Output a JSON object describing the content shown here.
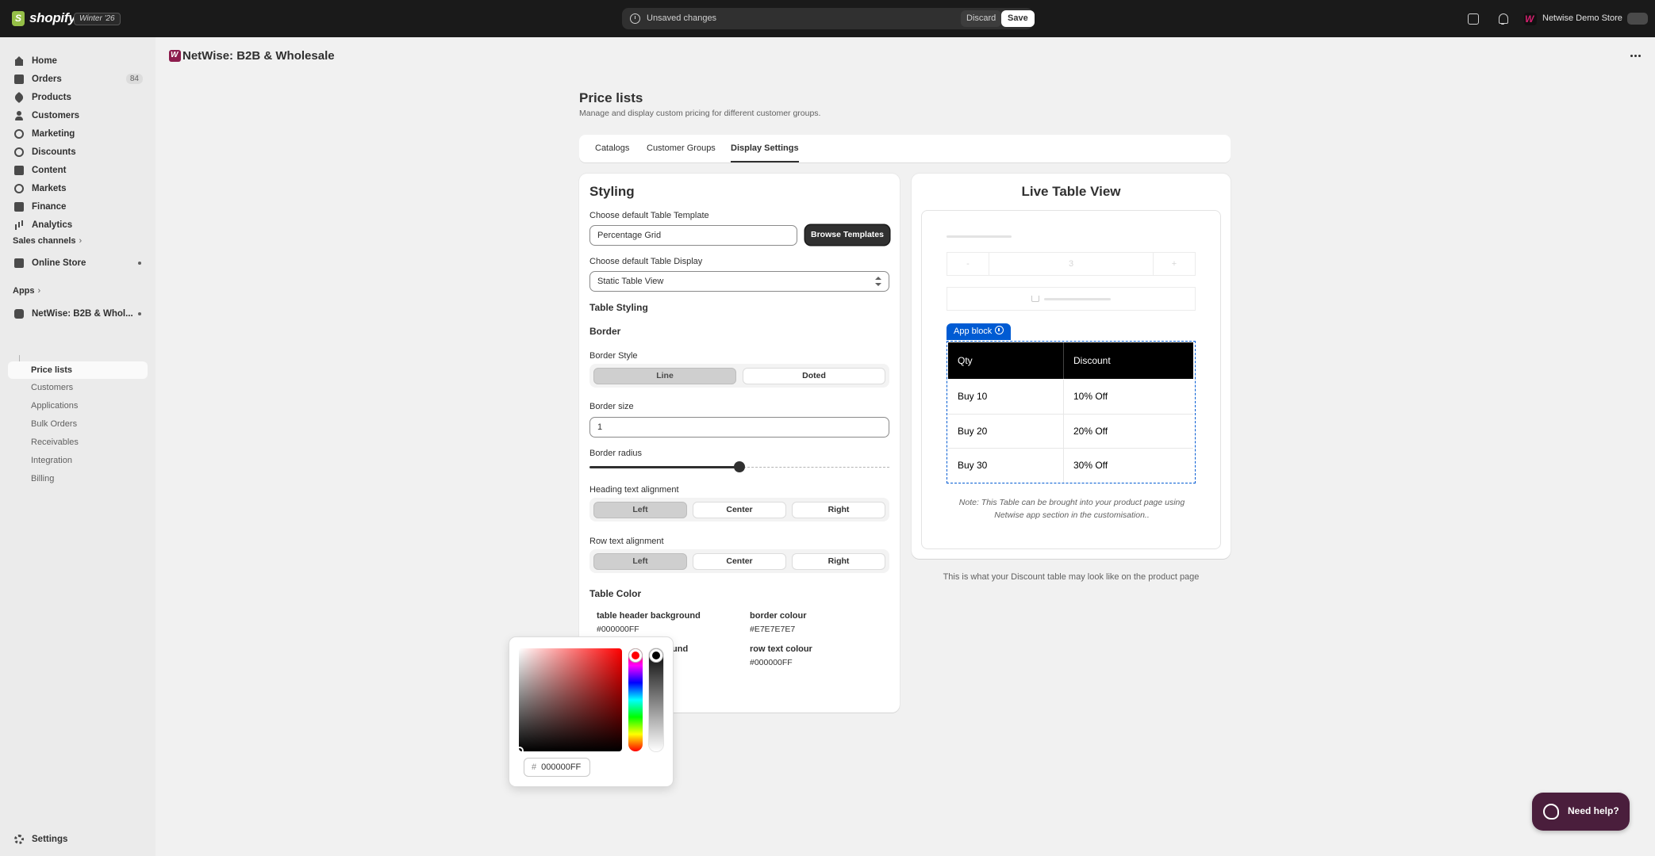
{
  "topbar": {
    "brand": "shopify",
    "edition": "Winter '26",
    "unsaved_text": "Unsaved changes",
    "discard_label": "Discard",
    "save_label": "Save",
    "store_name": "Netwise Demo Store"
  },
  "sidebar": {
    "items": [
      {
        "label": "Home",
        "icon": "home-icon"
      },
      {
        "label": "Orders",
        "icon": "orders-icon",
        "count": "84"
      },
      {
        "label": "Products",
        "icon": "tag-icon"
      },
      {
        "label": "Customers",
        "icon": "person-icon"
      },
      {
        "label": "Marketing",
        "icon": "target-icon"
      },
      {
        "label": "Discounts",
        "icon": "discount-icon"
      },
      {
        "label": "Content",
        "icon": "content-icon"
      },
      {
        "label": "Markets",
        "icon": "globe-icon"
      },
      {
        "label": "Finance",
        "icon": "bank-icon"
      },
      {
        "label": "Analytics",
        "icon": "chart-icon"
      }
    ],
    "sales_channels_label": "Sales channels",
    "online_store_label": "Online Store",
    "apps_label": "Apps",
    "app_name": "NetWise: B2B & Whol...",
    "app_sub_active": "Price lists",
    "app_sub_items": [
      "Customers",
      "Applications",
      "Bulk Orders",
      "Receivables",
      "Integration",
      "Billing"
    ],
    "settings_label": "Settings"
  },
  "header": {
    "app_title": "NetWise: B2B & Wholesale"
  },
  "page": {
    "title": "Price lists",
    "subtitle": "Manage and display custom pricing for different customer groups.",
    "tabs": [
      "Catalogs",
      "Customer Groups",
      "Display Settings"
    ],
    "active_tab": "Display Settings"
  },
  "styling": {
    "heading": "Styling",
    "template_label": "Choose default Table Template",
    "template_value": "Percentage Grid",
    "browse_label": "Browse Templates",
    "display_label": "Choose default Table Display",
    "display_value": "Static Table View",
    "table_styling_heading": "Table Styling",
    "border_heading": "Border",
    "border_style_label": "Border Style",
    "border_style_options": [
      "Line",
      "Doted"
    ],
    "border_style_selected": "Line",
    "border_size_label": "Border size",
    "border_size_value": "1",
    "border_radius_label": "Border radius",
    "border_radius_fraction": 0.5,
    "heading_align_label": "Heading text alignment",
    "heading_align_options": [
      "Left",
      "Center",
      "Right"
    ],
    "heading_align_selected": "Left",
    "row_align_label": "Row text alignment",
    "row_align_options": [
      "Left",
      "Center",
      "Right"
    ],
    "row_align_selected": "Left",
    "table_color_heading": "Table Color",
    "colors": {
      "header_bg_label": "table header background",
      "header_bg_value": "#000000FF",
      "border_colour_label": "border colour",
      "border_colour_value": "#E7E7E7E7",
      "row_bg_label_partial": "und",
      "row_text_label": "row text colour",
      "row_text_value": "#000000FF"
    }
  },
  "color_picker": {
    "hash": "#",
    "hex_value": "000000FF"
  },
  "live_view": {
    "heading": "Live Table View",
    "qty_minus": "-",
    "qty_value": "3",
    "qty_plus": "+",
    "app_block_label": "App block",
    "table_headers": [
      "Qty",
      "Discount"
    ],
    "rows": [
      {
        "qty": "Buy 10",
        "discount": "10% Off"
      },
      {
        "qty": "Buy 20",
        "discount": "20% Off"
      },
      {
        "qty": "Buy 30",
        "discount": "30% Off"
      }
    ],
    "note": "Note: This Table can be brought into your product page using Netwise app section in the customisation..",
    "caption": "This is what your Discount table may look like on the product page"
  },
  "help": {
    "label": "Need help?"
  }
}
